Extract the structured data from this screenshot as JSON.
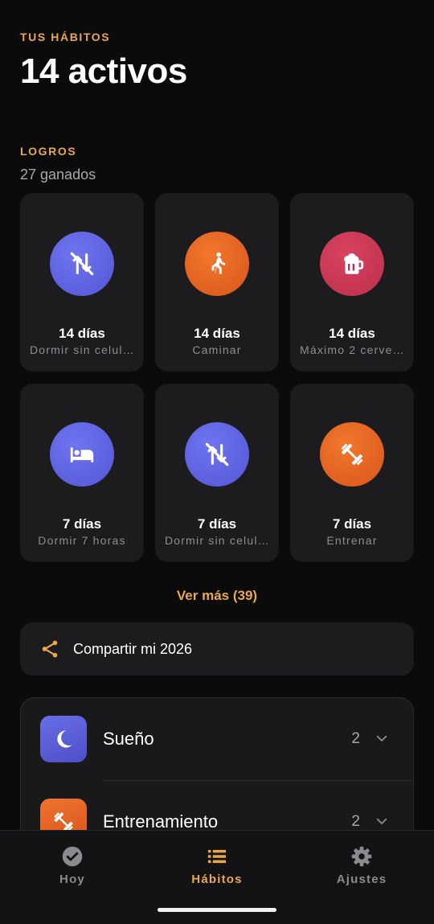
{
  "header": {
    "eyebrow": "TUS HÁBITOS",
    "title": "14 activos"
  },
  "achievements": {
    "eyebrow": "LOGROS",
    "count": "27 ganados",
    "cards": [
      {
        "days": "14 días",
        "name": "Dormir sin celular",
        "icon": "phone-off-icon",
        "color": "purple"
      },
      {
        "days": "14 días",
        "name": "Caminar",
        "icon": "walking-icon",
        "color": "orange"
      },
      {
        "days": "14 días",
        "name": "Máximo 2 cervezas",
        "icon": "beer-mug-icon",
        "color": "red"
      },
      {
        "days": "7 días",
        "name": "Dormir 7 horas",
        "icon": "bed-icon",
        "color": "purple"
      },
      {
        "days": "7 días",
        "name": "Dormir sin celular",
        "icon": "phone-off-icon",
        "color": "purple"
      },
      {
        "days": "7 días",
        "name": "Entrenar",
        "icon": "dumbbell-icon",
        "color": "orange"
      }
    ],
    "see_more": "Ver más (39)"
  },
  "share": {
    "label": "Compartir mi 2026",
    "icon": "share-icon"
  },
  "groups": [
    {
      "name": "Sueño",
      "count": "2",
      "icon": "moon-icon",
      "color": "#5a5fd8"
    },
    {
      "name": "Entrenamiento",
      "count": "2",
      "icon": "dumbbell-icon",
      "color": "#e5631f"
    }
  ],
  "nav": {
    "items": [
      {
        "label": "Hoy",
        "icon": "check-circle-icon",
        "active": false
      },
      {
        "label": "Hábitos",
        "icon": "list-icon",
        "active": true
      },
      {
        "label": "Ajustes",
        "icon": "gear-icon",
        "active": false
      }
    ]
  },
  "colors": {
    "accent": "#e9a84a",
    "purple": "#5b5fe0",
    "orange": "#e5631f",
    "red": "#c9364f",
    "card": "#1c1c1f",
    "background": "#0b0b0c"
  }
}
